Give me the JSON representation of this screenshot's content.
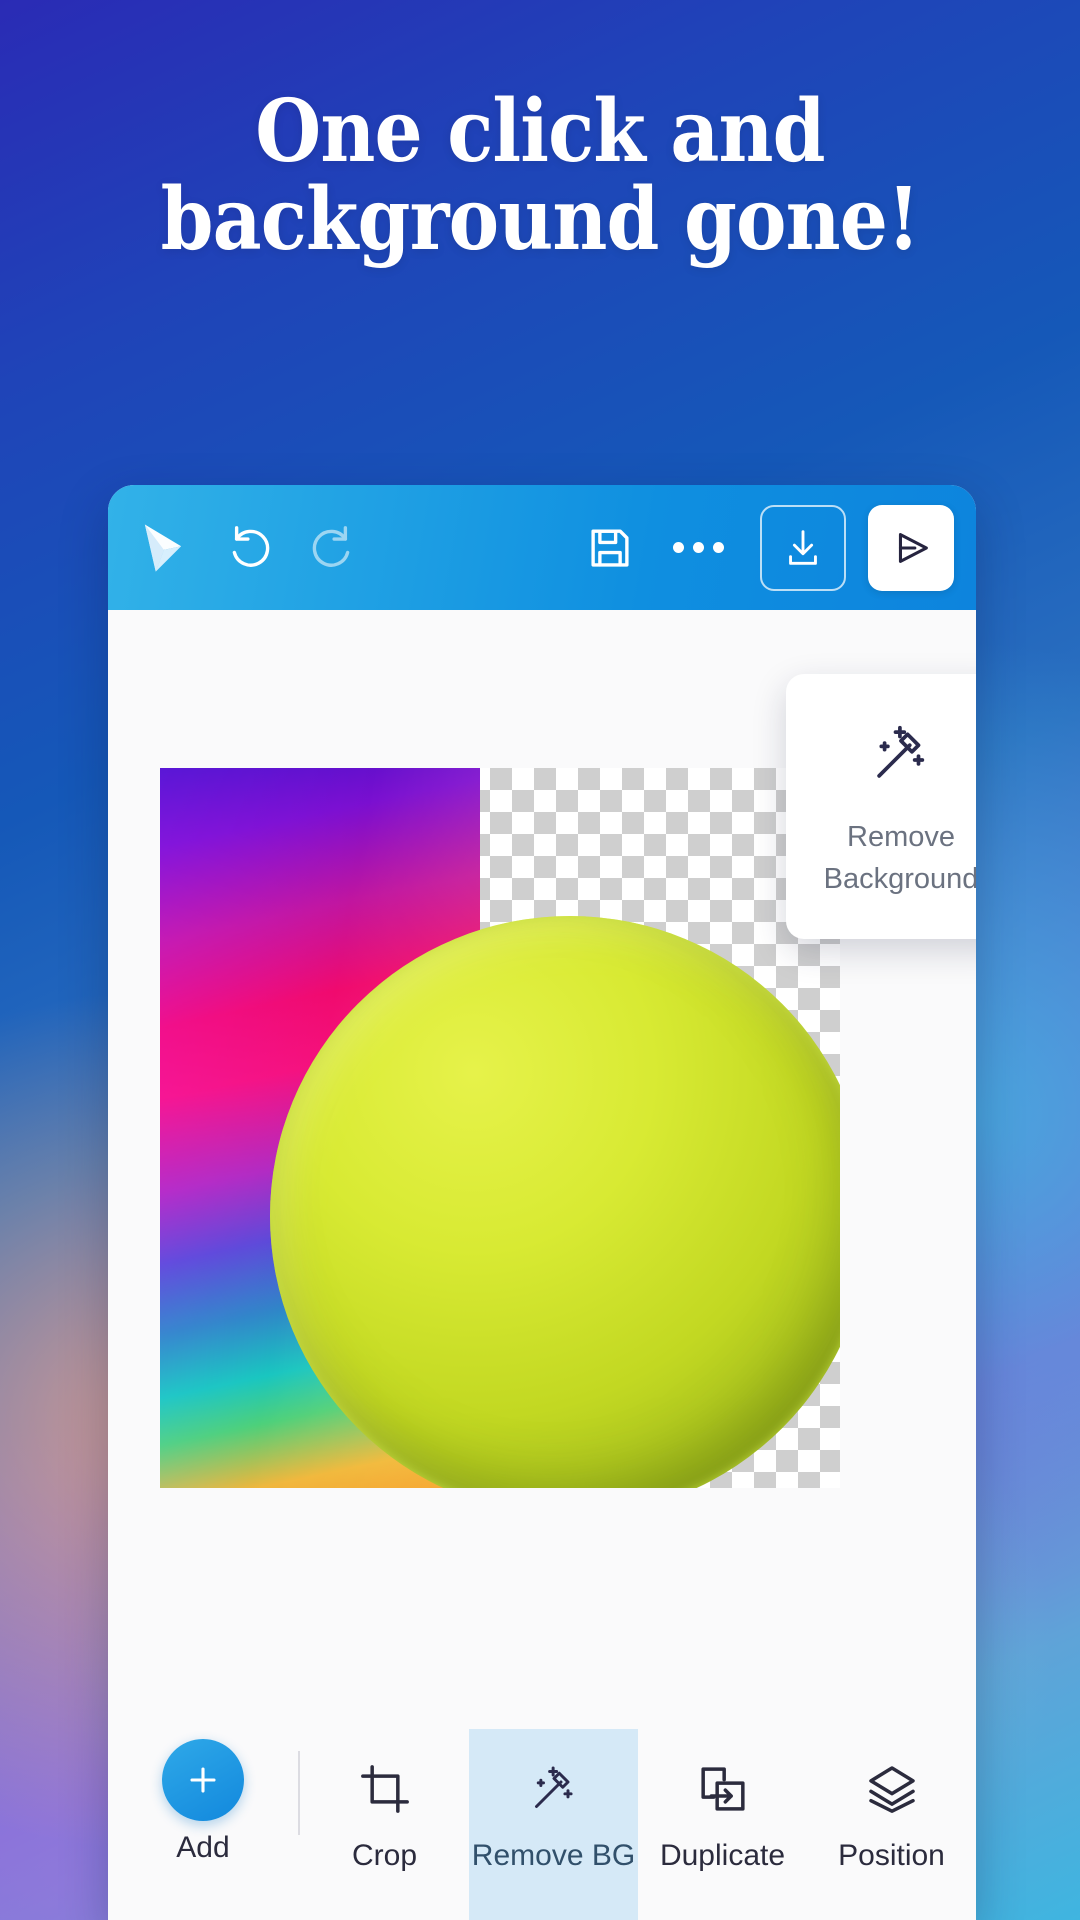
{
  "headline": {
    "line1": "One click and",
    "line2": "background gone!"
  },
  "colors": {
    "toolbar_blue": "#0f8fe0",
    "accent_blue": "#1288dd",
    "active_tool_bg": "#d5e9f7",
    "icon_navy": "#2b2b3d",
    "tooltip_text": "#6b7280",
    "ball_yellow": "#d8ea33"
  },
  "app": {
    "toolbar": {
      "logo": "app-logo-arrow",
      "undo_label": "Undo",
      "undo_icon": "undo-icon",
      "redo_label": "Redo",
      "redo_icon": "redo-icon",
      "redo_disabled": true,
      "save_label": "Save",
      "save_icon": "save-floppy-icon",
      "more_label": "More",
      "more_icon": "more-dots-icon",
      "download_label": "Download",
      "download_icon": "download-icon",
      "send_label": "Send",
      "send_icon": "send-arrow-icon"
    },
    "canvas": {
      "image_alt": "tennis-ball-photo",
      "transparency_checker": true,
      "tooltip": {
        "icon": "magic-wand-icon",
        "line1": "Remove",
        "line2": "Background"
      }
    },
    "bottombar": {
      "add": {
        "label": "Add",
        "icon": "plus-icon"
      },
      "tools": [
        {
          "label": "Crop",
          "icon": "crop-icon",
          "active": false
        },
        {
          "label": "Remove BG",
          "icon": "magic-wand-icon",
          "active": true
        },
        {
          "label": "Duplicate",
          "icon": "duplicate-icon",
          "active": false
        },
        {
          "label": "Position",
          "icon": "layers-icon",
          "active": false
        }
      ]
    }
  }
}
